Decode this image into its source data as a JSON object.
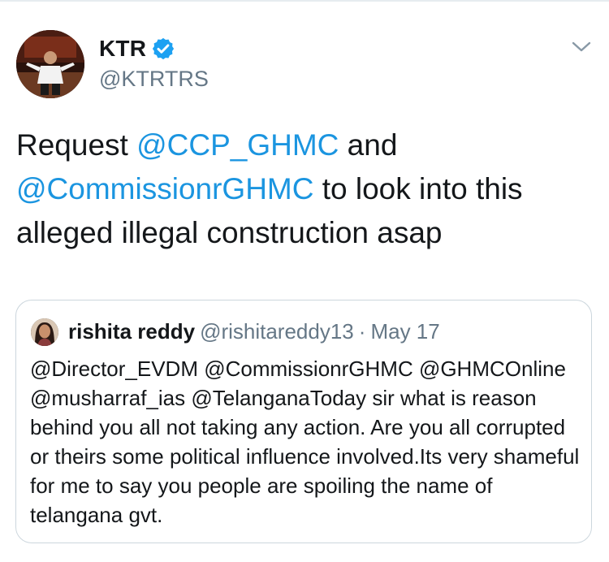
{
  "tweet": {
    "author_name": "KTR",
    "author_handle": "@KTRTRS",
    "verified": true,
    "text": {
      "part1": "Request ",
      "mention1": "@CCP_GHMC",
      "part2": " and",
      "mention2": "@CommissionrGHMC",
      "part3": " to look into this alleged illegal construction asap"
    }
  },
  "quoted_tweet": {
    "author_name": "rishita reddy",
    "author_handle": "@rishitareddy13",
    "separator": "·",
    "date": "May 17",
    "text": "@Director_EVDM @CommissionrGHMC @GHMCOnline @musharraf_ias @TelanganaToday sir what is reason behind you all not taking any action. Are you all corrupted or theirs some political influence involved.Its very shameful for me to say you people are spoiling the name of telangana gvt."
  },
  "icons": {
    "verified": "verified-badge-icon",
    "menu": "chevron-down-icon"
  },
  "colors": {
    "mention": "#1b95e0",
    "secondary_text": "#657786",
    "verified_badge": "#1da1f2",
    "border": "#ccd6dd"
  }
}
